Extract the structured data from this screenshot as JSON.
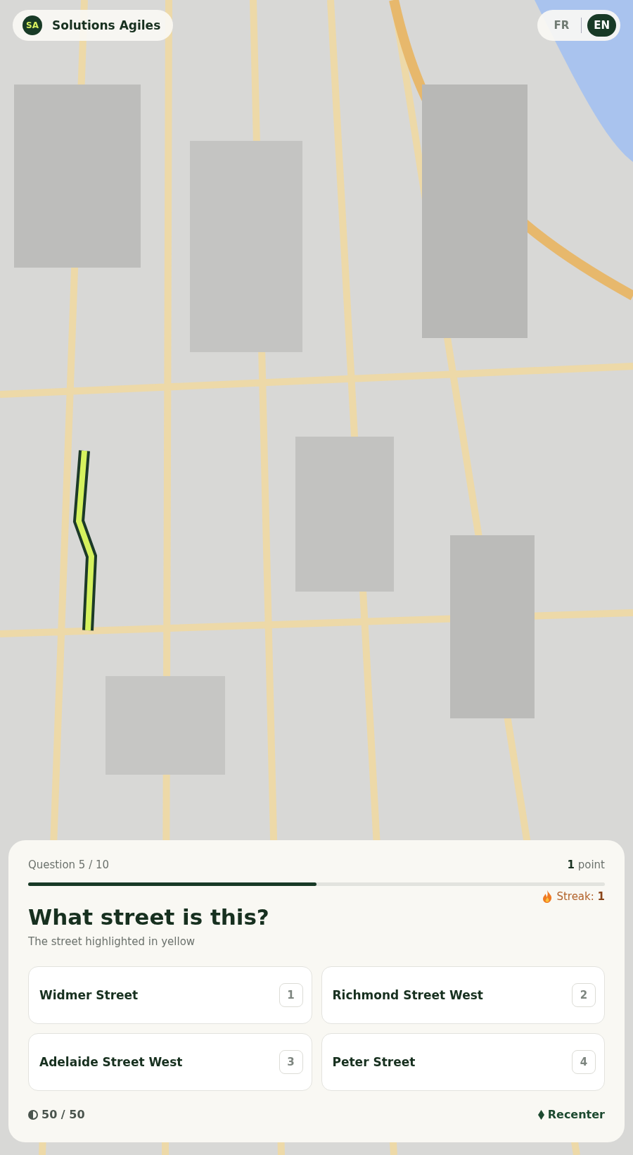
{
  "brand": {
    "initials": "SA",
    "name": "Solutions Agiles"
  },
  "languages": [
    {
      "label": "FR",
      "selected": false
    },
    {
      "label": "EN",
      "selected": true
    }
  ],
  "quiz": {
    "question_counter": "Question 5 / 10",
    "points": "**1** point",
    "progress": {
      "level": 0.5
    },
    "streak": "Streak: **1**",
    "title": "What street is this?",
    "subtitle": "The street highlighted in yellow",
    "answers": [
      {
        "label": "Widmer Street",
        "key": "1"
      },
      {
        "label": "Richmond Street West",
        "key": "2"
      },
      {
        "label": "Adelaide Street West",
        "key": "3"
      },
      {
        "label": "Peter Street",
        "key": "4"
      }
    ],
    "lives": "50 / 50",
    "recenter": "Recenter"
  }
}
